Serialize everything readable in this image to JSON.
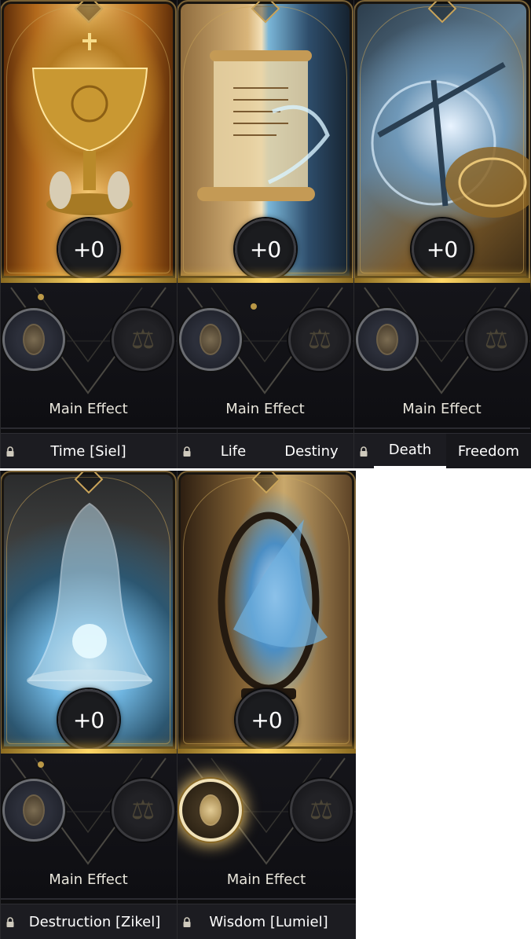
{
  "cards": [
    {
      "id": "time",
      "art_icon": "chalice-icon",
      "bonus": "+0",
      "main_effect_label": "Main Effect",
      "main_slot_icon": "oval-gem-icon",
      "sub_slot_icon": "scales-icon",
      "name": "Time [Siel]",
      "locked": true
    },
    {
      "id": "life-destiny",
      "art_icon": "scroll-icon",
      "bonus": "+0",
      "main_effect_label": "Main Effect",
      "main_slot_icon": "oval-gem-icon",
      "sub_slot_icon": "scales-icon",
      "tabs": [
        "Life",
        "Destiny"
      ],
      "locked": true
    },
    {
      "id": "death-freedom",
      "art_icon": "compass-icon",
      "bonus": "+0",
      "main_effect_label": "Main Effect",
      "main_slot_icon": "oval-gem-icon",
      "sub_slot_icon": "scales-icon",
      "tabs": [
        "Death",
        "Freedom"
      ],
      "locked": true
    },
    {
      "id": "destruction",
      "art_icon": "bell-icon",
      "bonus": "+0",
      "main_effect_label": "Main Effect",
      "main_slot_icon": "oval-gem-icon",
      "sub_slot_icon": "scales-icon",
      "name": "Destruction [Zikel]",
      "locked": true
    },
    {
      "id": "wisdom",
      "art_icon": "mirror-icon",
      "bonus": "+0",
      "main_effect_label": "Main Effect",
      "main_slot_icon": "oval-gem-icon",
      "main_slot_active": true,
      "sub_slot_icon": "scales-icon",
      "name": "Wisdom [Lumiel]",
      "locked": true
    }
  ],
  "colors": {
    "gold_glow": "#ffd766",
    "panel_bg": "#0e0e12",
    "name_bar_bg": "#1c1c21",
    "text": "#ffffff"
  }
}
